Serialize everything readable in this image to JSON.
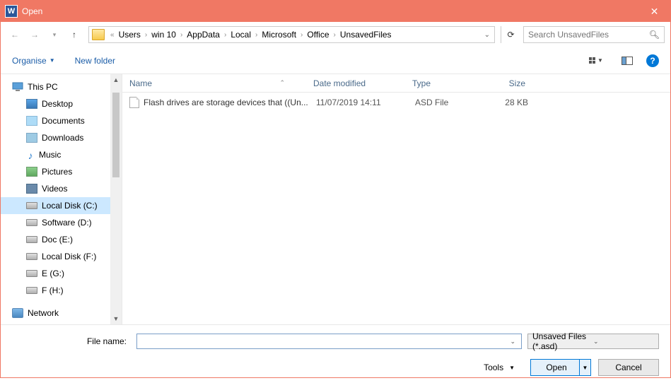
{
  "title": "Open",
  "breadcrumbs": [
    "Users",
    "win 10",
    "AppData",
    "Local",
    "Microsoft",
    "Office",
    "UnsavedFiles"
  ],
  "search_placeholder": "Search UnsavedFiles",
  "toolbar": {
    "organise": "Organise",
    "new_folder": "New folder"
  },
  "columns": {
    "name": "Name",
    "date": "Date modified",
    "type": "Type",
    "size": "Size"
  },
  "sidebar": {
    "this_pc": "This PC",
    "items": [
      {
        "label": "Desktop",
        "icon": "desktop"
      },
      {
        "label": "Documents",
        "icon": "doc"
      },
      {
        "label": "Downloads",
        "icon": "down"
      },
      {
        "label": "Music",
        "icon": "music"
      },
      {
        "label": "Pictures",
        "icon": "pic"
      },
      {
        "label": "Videos",
        "icon": "vid"
      },
      {
        "label": "Local Disk (C:)",
        "icon": "disk",
        "selected": true
      },
      {
        "label": "Software (D:)",
        "icon": "disk"
      },
      {
        "label": "Doc (E:)",
        "icon": "disk"
      },
      {
        "label": "Local Disk (F:)",
        "icon": "disk"
      },
      {
        "label": "E (G:)",
        "icon": "disk"
      },
      {
        "label": "F (H:)",
        "icon": "disk"
      }
    ],
    "network": "Network"
  },
  "files": [
    {
      "name": "Flash drives are storage devices that ((Un...",
      "date": "11/07/2019 14:11",
      "type": "ASD File",
      "size": "28 KB"
    }
  ],
  "filename_label": "File name:",
  "filter": "Unsaved Files (*.asd)",
  "tools_label": "Tools",
  "open_label": "Open",
  "cancel_label": "Cancel"
}
